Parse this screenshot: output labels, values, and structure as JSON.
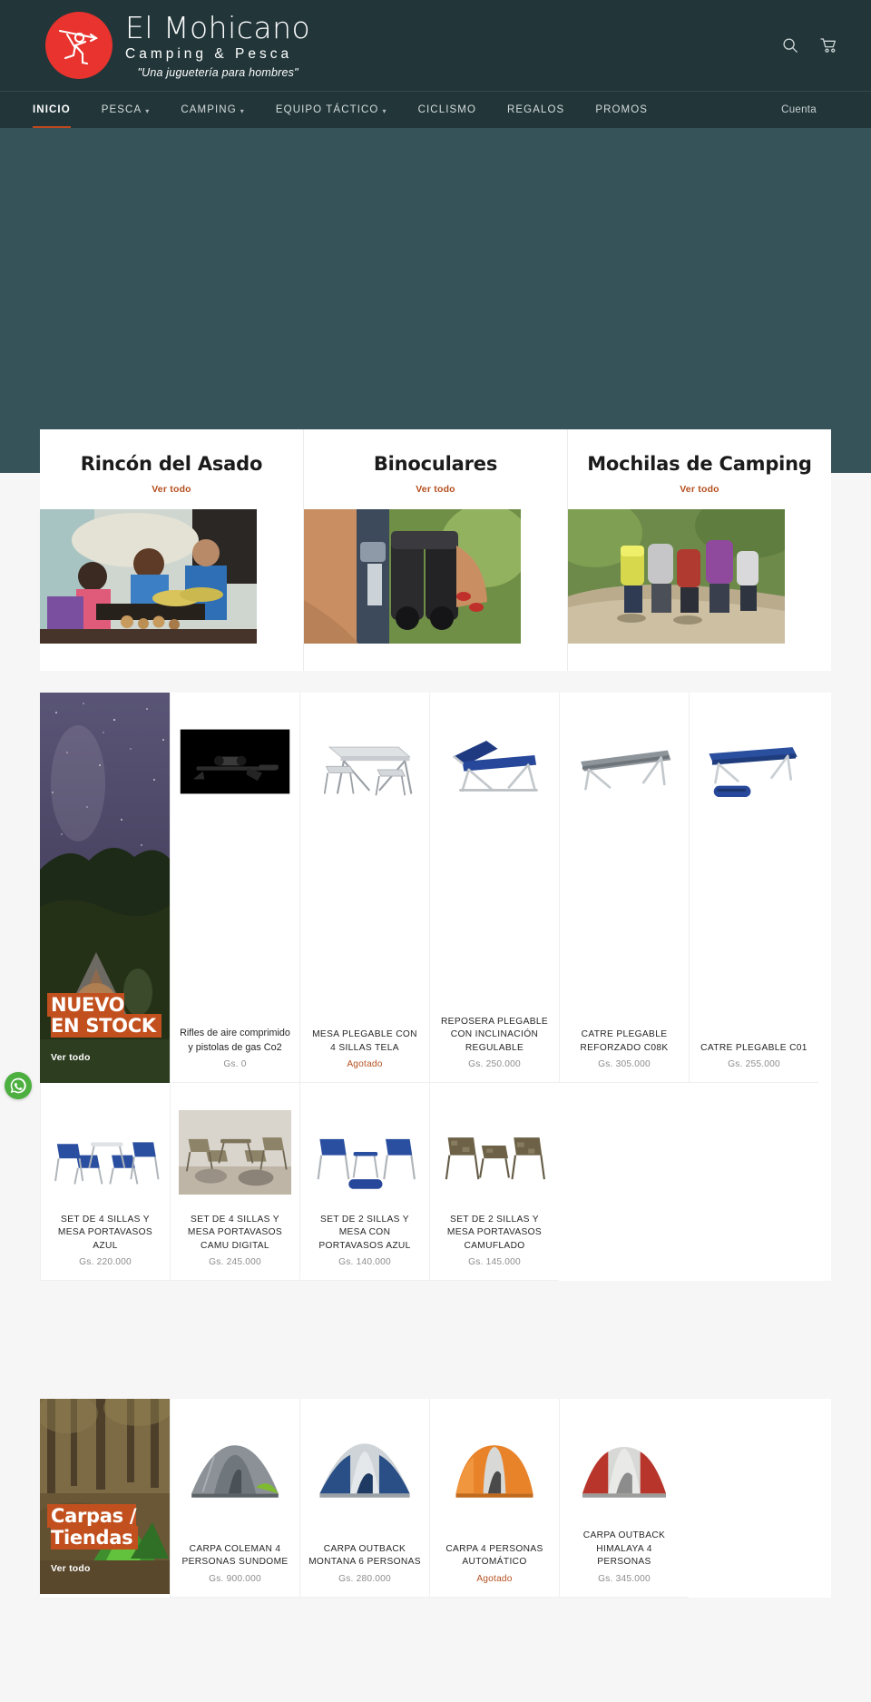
{
  "header": {
    "logo": {
      "title": "El Mohicano",
      "subtitle": "Camping & Pesca",
      "tagline": "\"Una juguetería para hombres\"",
      "mark_icon": "spear-thrower-icon",
      "brand_color": "#e8332e"
    },
    "icons": [
      {
        "name": "search-icon",
        "label": "Buscar"
      },
      {
        "name": "cart-icon",
        "label": "Carrito"
      }
    ],
    "nav": [
      {
        "label": "INICIO",
        "has_dropdown": false,
        "active": true
      },
      {
        "label": "PESCA",
        "has_dropdown": true,
        "active": false
      },
      {
        "label": "CAMPING",
        "has_dropdown": true,
        "active": false
      },
      {
        "label": "EQUIPO TÁCTICO",
        "has_dropdown": true,
        "active": false
      },
      {
        "label": "CICLISMO",
        "has_dropdown": false,
        "active": false
      },
      {
        "label": "REGALOS",
        "has_dropdown": false,
        "active": false
      },
      {
        "label": "PROMOS",
        "has_dropdown": false,
        "active": false
      }
    ],
    "account_label": "Cuenta",
    "bar_color": "#22363a",
    "active_underline_color": "#c0481f"
  },
  "hero": {
    "background_color": "#37535a"
  },
  "categories": [
    {
      "title": "Rincón del Asado",
      "link_label": "Ver todo",
      "image": "barbecue-family-photo"
    },
    {
      "title": "Binoculares",
      "link_label": "Ver todo",
      "image": "woman-with-binoculars-photo"
    },
    {
      "title": "Mochilas de Camping",
      "link_label": "Ver todo",
      "image": "hikers-with-backpacks-photo"
    }
  ],
  "link_color": "#b4501f",
  "blocks": [
    {
      "promo": {
        "title": "NUEVO EN STOCK",
        "link_label": "Ver todo",
        "image": "night-sky-tent-photo",
        "highlight_color": "#c1501e"
      },
      "products": [
        {
          "name": "Rifles de aire comprimido y pistolas de gas Co2",
          "price": "Gs. 0",
          "sold_out": false,
          "lowercase": true,
          "image": "air-rifle-photo"
        },
        {
          "name": "MESA PLEGABLE CON 4 SILLAS TELA",
          "price": "Agotado",
          "sold_out": true,
          "lowercase": false,
          "image": "folding-table-chairs-photo"
        },
        {
          "name": "REPOSERA PLEGABLE CON INCLINACIÓN REGULABLE",
          "price": "Gs. 250.000",
          "sold_out": false,
          "lowercase": false,
          "image": "blue-lounger-photo"
        },
        {
          "name": "CATRE PLEGABLE REFORZADO C08K",
          "price": "Gs. 305.000",
          "sold_out": false,
          "lowercase": false,
          "image": "grey-cot-photo"
        },
        {
          "name": "CATRE PLEGABLE C01",
          "price": "Gs. 255.000",
          "sold_out": false,
          "lowercase": false,
          "image": "blue-cot-photo"
        },
        {
          "name": "SET DE 4 SILLAS Y MESA PORTAVASOS AZUL",
          "price": "Gs. 220.000",
          "sold_out": false,
          "lowercase": false,
          "image": "blue-chair-set-photo"
        },
        {
          "name": "SET DE 4 SILLAS Y MESA PORTAVASOS CAMU DIGITAL",
          "price": "Gs. 245.000",
          "sold_out": false,
          "lowercase": false,
          "image": "camo-chair-set-photo"
        },
        {
          "name": "SET DE 2 SILLAS Y MESA CON PORTAVASOS AZUL",
          "price": "Gs. 140.000",
          "sold_out": false,
          "lowercase": false,
          "image": "blue-2chair-set-photo"
        },
        {
          "name": "SET DE 2 SILLAS Y MESA PORTAVASOS CAMUFLADO",
          "price": "Gs. 145.000",
          "sold_out": false,
          "lowercase": false,
          "image": "camo-2chair-set-photo"
        }
      ]
    },
    {
      "promo": {
        "title": "Carpas / Tiendas",
        "link_label": "Ver todo",
        "image": "forest-tent-photo",
        "highlight_color": "#c1501e"
      },
      "products": [
        {
          "name": "CARPA COLEMAN 4 PERSONAS SUNDOME",
          "price": "Gs. 900.000",
          "sold_out": false,
          "lowercase": false,
          "image": "green-dome-tent-photo"
        },
        {
          "name": "CARPA OUTBACK MONTANA 6 PERSONAS",
          "price": "Gs. 280.000",
          "sold_out": false,
          "lowercase": false,
          "image": "blue-dome-tent-photo"
        },
        {
          "name": "CARPA 4 PERSONAS AUTOMÁTICO",
          "price": "Agotado",
          "sold_out": true,
          "lowercase": false,
          "image": "orange-tent-photo"
        },
        {
          "name": "CARPA OUTBACK HIMALAYA 4 PERSONAS",
          "price": "Gs. 345.000",
          "sold_out": false,
          "lowercase": false,
          "image": "red-tent-photo"
        }
      ]
    }
  ],
  "whatsapp": {
    "name": "whatsapp-button",
    "color": "#4caf3f"
  }
}
